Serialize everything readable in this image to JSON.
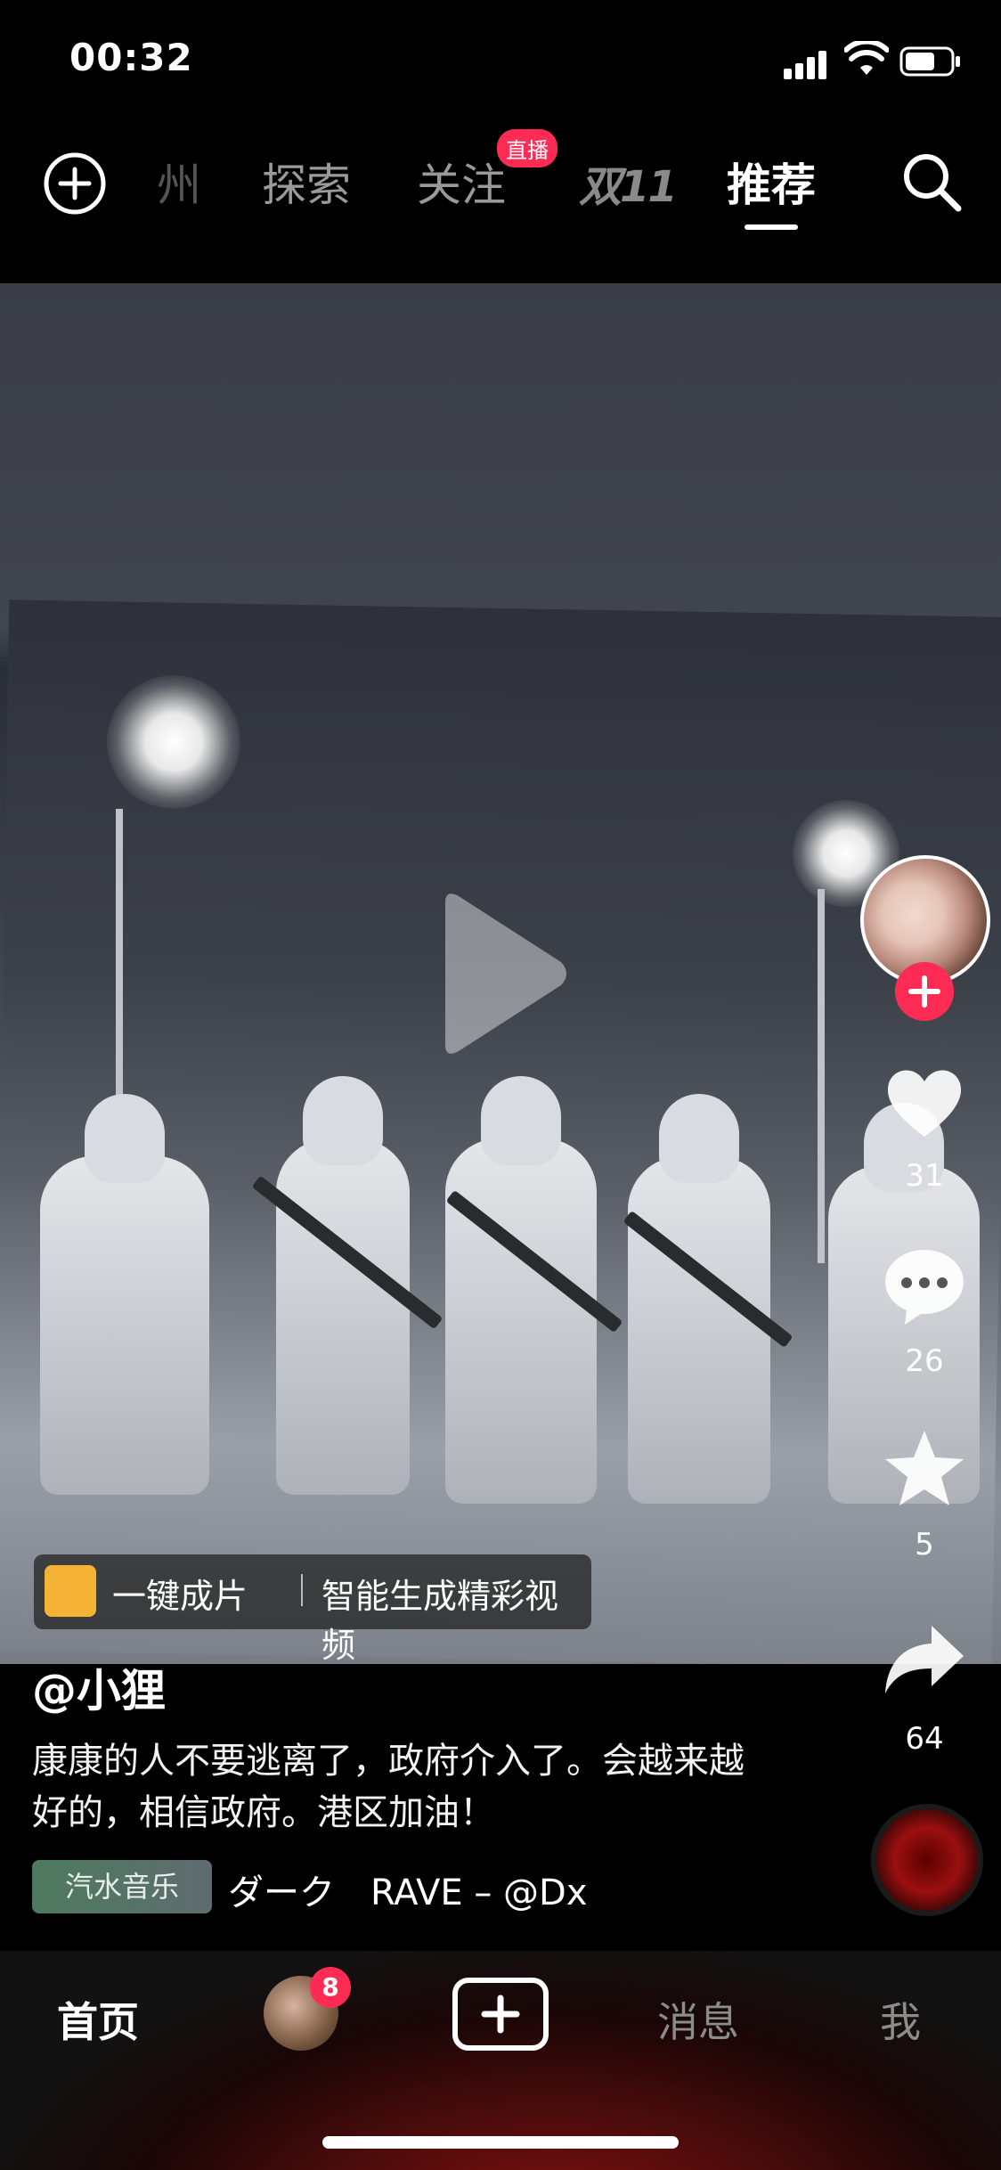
{
  "status_bar": {
    "time": "00:32"
  },
  "top_nav": {
    "tabs": [
      {
        "label": "州"
      },
      {
        "label": "探索"
      },
      {
        "label": "关注"
      },
      {
        "label": "双11"
      },
      {
        "label": "推荐"
      }
    ],
    "live_badge": "直播",
    "active_tab": "推荐"
  },
  "video": {
    "cta_title": "一键成片",
    "cta_subtitle": "智能生成精彩视频"
  },
  "right_rail": {
    "like_count": "31",
    "comment_count": "26",
    "favorite_count": "5",
    "share_count": "64"
  },
  "caption": {
    "author": "@小狸",
    "description": "康康的人不要逃离了，政府介入了。会越来越好的，相信政府。港区加油！",
    "music_tag": "汽水音乐",
    "music_title": "ダーク　RAVE – @Dx"
  },
  "bottom_bar": {
    "home_label": "首页",
    "friends_badge": "8",
    "messages_label": "消息",
    "me_label": "我"
  },
  "colors": {
    "accent": "#fe2c55",
    "background": "#000000"
  }
}
